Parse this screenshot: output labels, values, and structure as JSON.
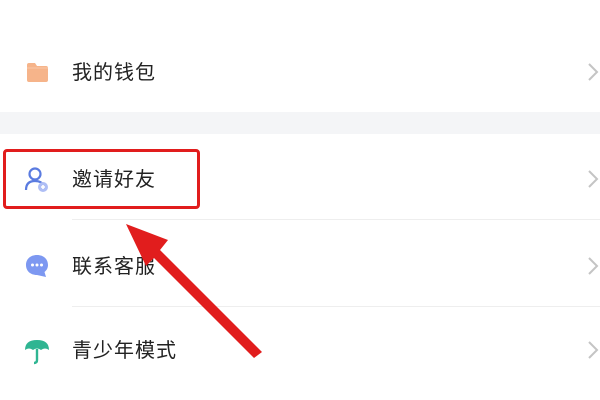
{
  "menu": {
    "items": [
      {
        "label": "我的钱包",
        "icon": "wallet-icon"
      },
      {
        "label": "邀请好友",
        "icon": "invite-friends-icon"
      },
      {
        "label": "联系客服",
        "icon": "customer-service-icon"
      },
      {
        "label": "青少年模式",
        "icon": "youth-mode-icon"
      }
    ],
    "chevron_icon": "chevron-right-icon"
  },
  "annotation": {
    "highlighted_item": "邀请好友",
    "box_color": "#e11d1d",
    "arrow_color": "#e11d1d"
  },
  "colors": {
    "wallet_icon": "#f6b48a",
    "invite_icon": "#5a7be0",
    "service_icon": "#6e8ef0",
    "youth_icon": "#2fb592",
    "separator": "#f4f5f7",
    "text": "#222222",
    "chevron": "#c4c4c4"
  }
}
